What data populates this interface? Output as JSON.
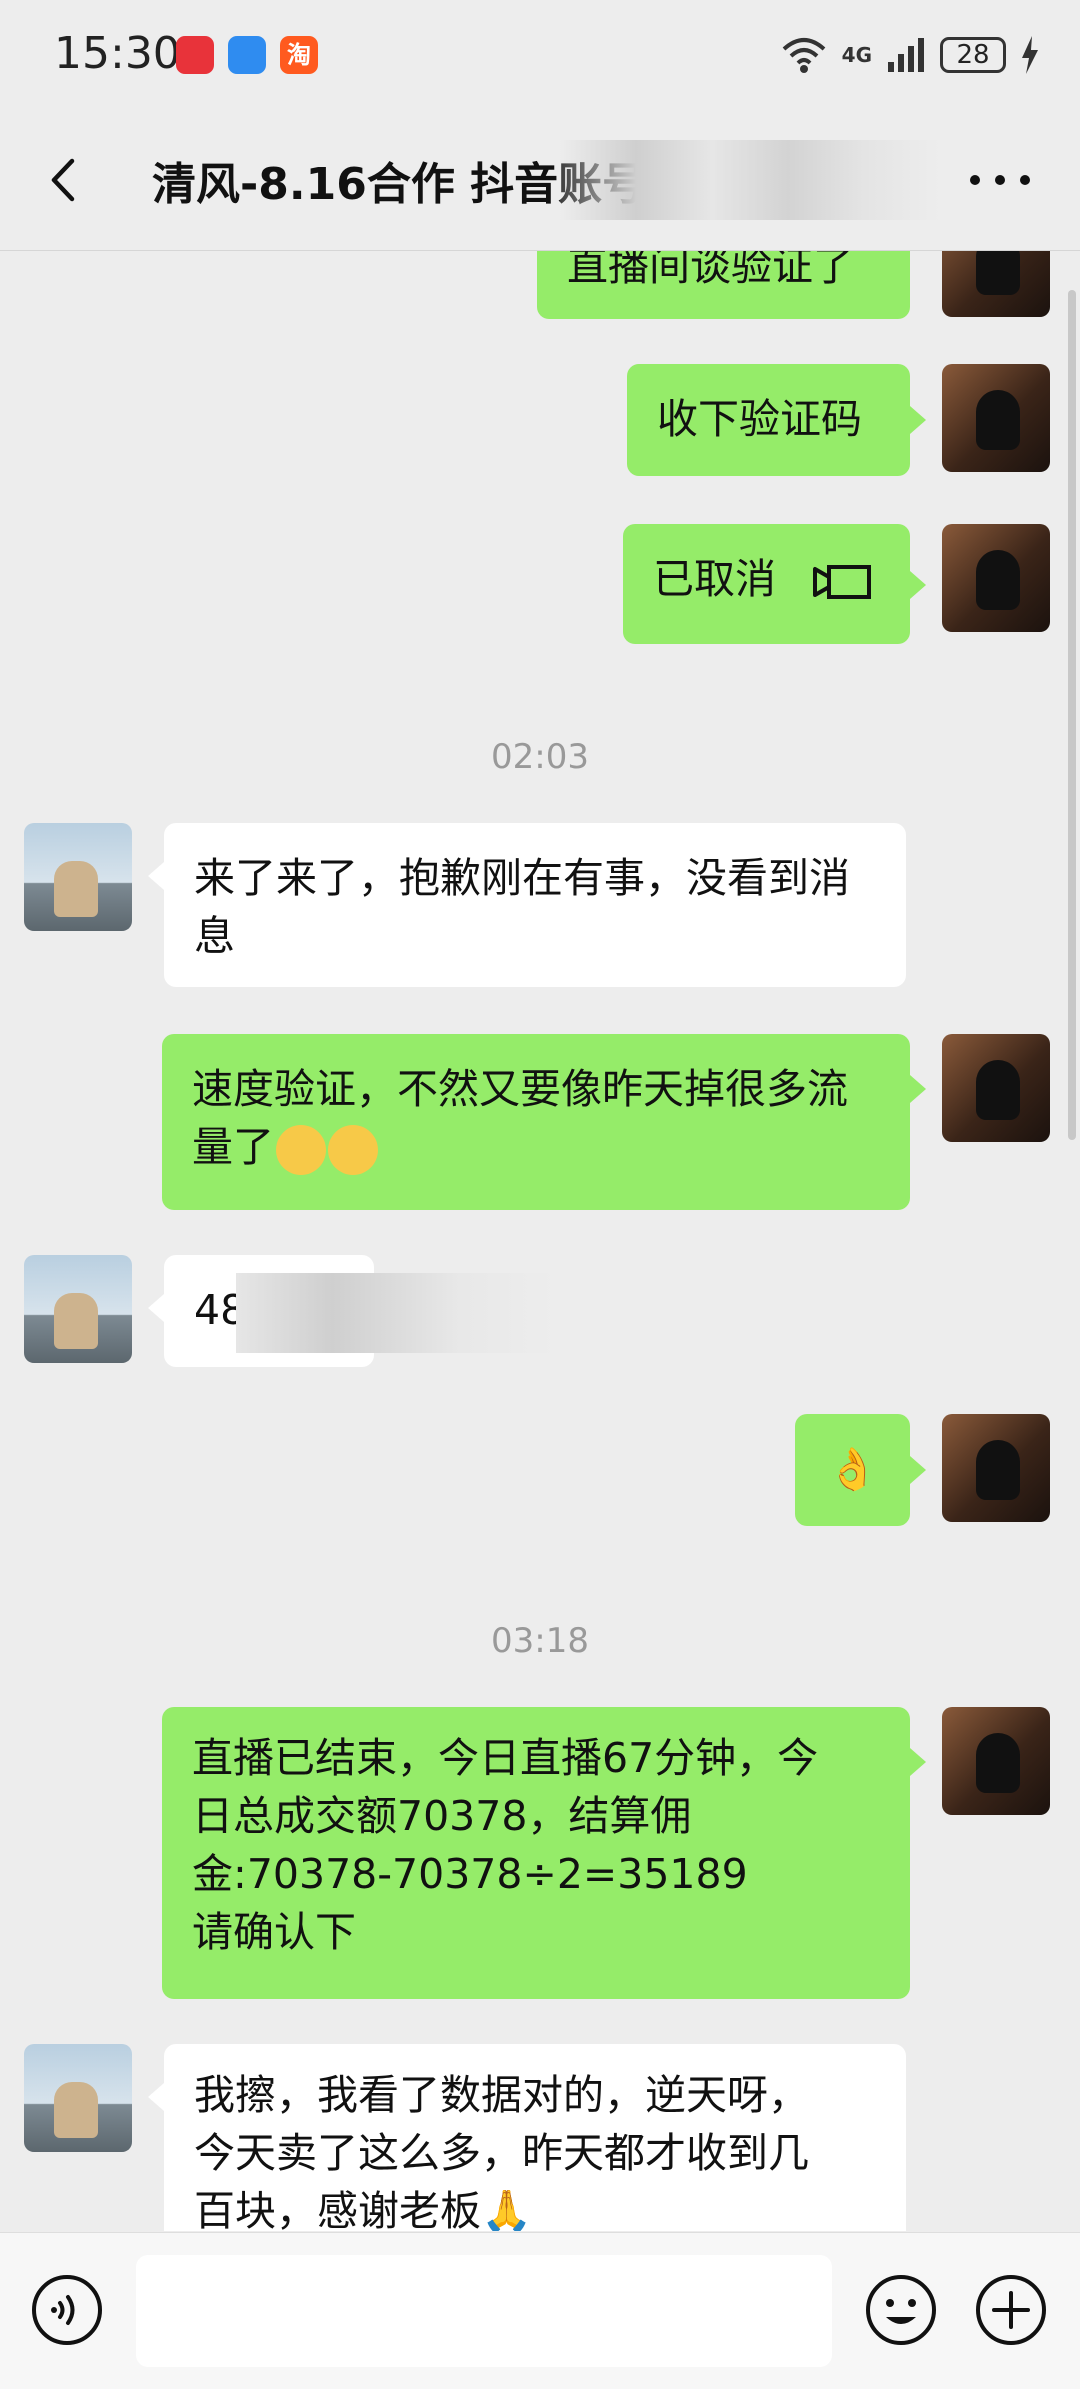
{
  "status_bar": {
    "time": "15:30",
    "battery": "28",
    "network": "4G",
    "taobao_glyph": "淘"
  },
  "header": {
    "title": "清风-8.16合作 抖音账号急..."
  },
  "messages": {
    "m0": "直播间谈验证了",
    "m1": "收下验证码",
    "m2": "已取消",
    "t1": "02:03",
    "m3": "来了来了，抱歉刚在有事，没看到消息",
    "m4": "速度验证，不然又要像昨天掉很多流量了",
    "m5": "489",
    "m6": "👌",
    "t2": "03:18",
    "m7_l1": "直播已结束，今日直播67分钟，今",
    "m7_l2": "日总成交额70378，结算佣",
    "m7_l3": "金:70378-70378÷2=35189",
    "m7_l4": "请确认下",
    "m8_l1": "我擦，我看了数据对的，逆天呀，",
    "m8_l2": "今天卖了这么多，昨天都才收到几",
    "m8_l3": "百块，感谢老板🙏"
  },
  "icons": {
    "back": "back-arrow-icon",
    "more": "more-dots-icon",
    "video": "video-call-icon",
    "voice": "voice-input-icon",
    "emoji": "emoji-icon",
    "plus": "plus-icon"
  },
  "colors": {
    "out_bubble": "#95ec69",
    "in_bubble": "#ffffff",
    "bg": "#ededed"
  }
}
